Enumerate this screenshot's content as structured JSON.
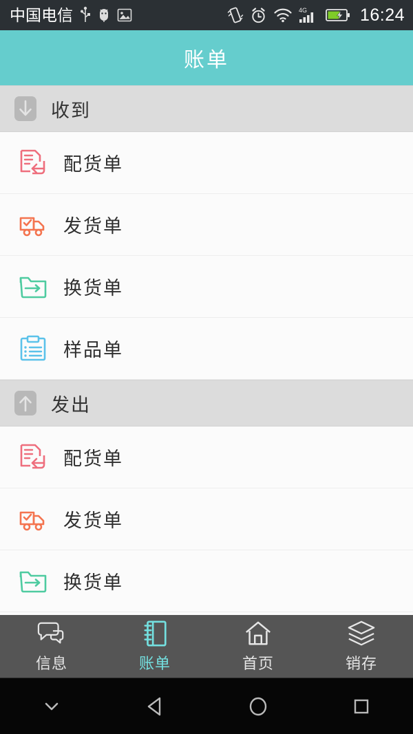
{
  "status_bar": {
    "carrier": "中国电信",
    "time": "16:24",
    "left_icons": [
      "usb-icon",
      "android-debug-icon",
      "screenshot-icon"
    ],
    "right_icons": [
      "vibrate-icon",
      "alarm-icon",
      "wifi-icon",
      "signal-4g-icon",
      "battery-charging-icon"
    ],
    "network_label": "4G",
    "background": "#2b3034"
  },
  "header": {
    "title": "账单",
    "background": "#65cdcd",
    "text_color": "#ffffff"
  },
  "sections": [
    {
      "id": "received",
      "label": "收到",
      "icon": "arrow-down-box-icon",
      "rows": [
        {
          "id": "received-allocation",
          "label": "配货单",
          "icon": "document-in-icon",
          "color": "#ee6e7d"
        },
        {
          "id": "received-shipment",
          "label": "发货单",
          "icon": "truck-check-icon",
          "color": "#f4744f"
        },
        {
          "id": "received-exchange",
          "label": "换货单",
          "icon": "folder-out-icon",
          "color": "#4ecba0"
        },
        {
          "id": "received-sample",
          "label": "样品单",
          "icon": "clipboard-list-icon",
          "color": "#5bc2ea"
        }
      ]
    },
    {
      "id": "sent",
      "label": "发出",
      "icon": "arrow-up-box-icon",
      "rows": [
        {
          "id": "sent-allocation",
          "label": "配货单",
          "icon": "document-in-icon",
          "color": "#ee6e7d"
        },
        {
          "id": "sent-shipment",
          "label": "发货单",
          "icon": "truck-check-icon",
          "color": "#f4744f"
        },
        {
          "id": "sent-exchange",
          "label": "换货单",
          "icon": "folder-out-icon",
          "color": "#4ecba0"
        }
      ]
    }
  ],
  "tab_bar": {
    "background": "#555555",
    "active_color": "#74e0e0",
    "inactive_color": "#e6e6e6",
    "items": [
      {
        "id": "messages",
        "label": "信息",
        "icon": "chat-bubbles-icon",
        "active": false
      },
      {
        "id": "bills",
        "label": "账单",
        "icon": "notebook-icon",
        "active": true
      },
      {
        "id": "home",
        "label": "首页",
        "icon": "house-icon",
        "active": false
      },
      {
        "id": "inventory",
        "label": "销存",
        "icon": "layers-icon",
        "active": false
      }
    ]
  },
  "nav_bar": {
    "buttons": [
      "chevron-down-icon",
      "back-triangle-icon",
      "home-circle-icon",
      "recents-square-icon"
    ]
  }
}
